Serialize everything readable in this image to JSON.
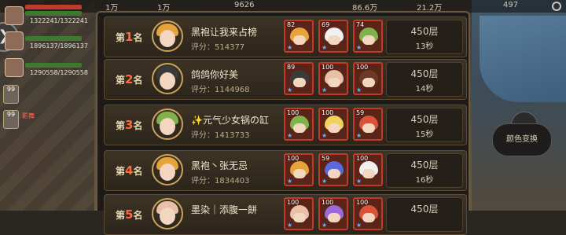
{
  "topbar": {
    "items": [
      "1万",
      "1万",
      "9626",
      "86.6万",
      "21.2万",
      "497"
    ]
  },
  "sidebar": {
    "players": [
      {
        "stats": "1322241/1322241"
      },
      {
        "stats": "1896137/1896137"
      },
      {
        "stats": "1290558/1290558"
      }
    ],
    "chips": [
      {
        "level": "99"
      },
      {
        "level": "99"
      }
    ],
    "tag": "影舞"
  },
  "right_panel": {
    "color_swap_label": "颜色变换"
  },
  "colors": {
    "accent_red": "#ff6a3d",
    "panel_bg": "#1d1a17",
    "row_border": "#5c4b32",
    "hero_border": "#c03a2a",
    "star_blue": "#5fb3ff"
  },
  "leaderboard": {
    "rank_suffix": "名",
    "rows": [
      {
        "rank_prefix": "第",
        "rank": "1",
        "name": "黑袍让我来占榜",
        "score": "评分：514377",
        "floor": "450层",
        "time": "13秒",
        "heroes": [
          {
            "lv": "82",
            "hair": "#e6a33a"
          },
          {
            "lv": "69",
            "hair": "#f0f0f0"
          },
          {
            "lv": "74",
            "hair": "#7fb24a"
          }
        ]
      },
      {
        "rank_prefix": "第",
        "rank": "2",
        "name": "鸽鸽你好美",
        "score": "评分：1144968",
        "floor": "450层",
        "time": "14秒",
        "heroes": [
          {
            "lv": "89",
            "hair": "#3a3a3a"
          },
          {
            "lv": "100",
            "hair": "#e8c0a8"
          },
          {
            "lv": "100",
            "hair": "#6b3a26"
          }
        ]
      },
      {
        "rank_prefix": "第",
        "rank": "3",
        "name": "✨元气少女锅の缸",
        "score": "评分：1413733",
        "floor": "450层",
        "time": "15秒",
        "heroes": [
          {
            "lv": "100",
            "hair": "#7fb24a"
          },
          {
            "lv": "100",
            "hair": "#f0d35a"
          },
          {
            "lv": "59",
            "hair": "#d9533a"
          }
        ]
      },
      {
        "rank_prefix": "第",
        "rank": "4",
        "name": "黑袍丶张无忌",
        "score": "评分：1834403",
        "floor": "450层",
        "time": "16秒",
        "heroes": [
          {
            "lv": "100",
            "hair": "#e6a33a"
          },
          {
            "lv": "59",
            "hair": "#5a6ad8"
          },
          {
            "lv": "100",
            "hair": "#f0f0f0"
          }
        ]
      },
      {
        "rank_prefix": "第",
        "rank": "5",
        "name": "墨染｜添腹一餅",
        "score": "",
        "floor": "450层",
        "time": "",
        "heroes": [
          {
            "lv": "100",
            "hair": "#e8c0a8"
          },
          {
            "lv": "100",
            "hair": "#9a6ad8"
          },
          {
            "lv": "100",
            "hair": "#d9533a"
          }
        ]
      }
    ]
  }
}
